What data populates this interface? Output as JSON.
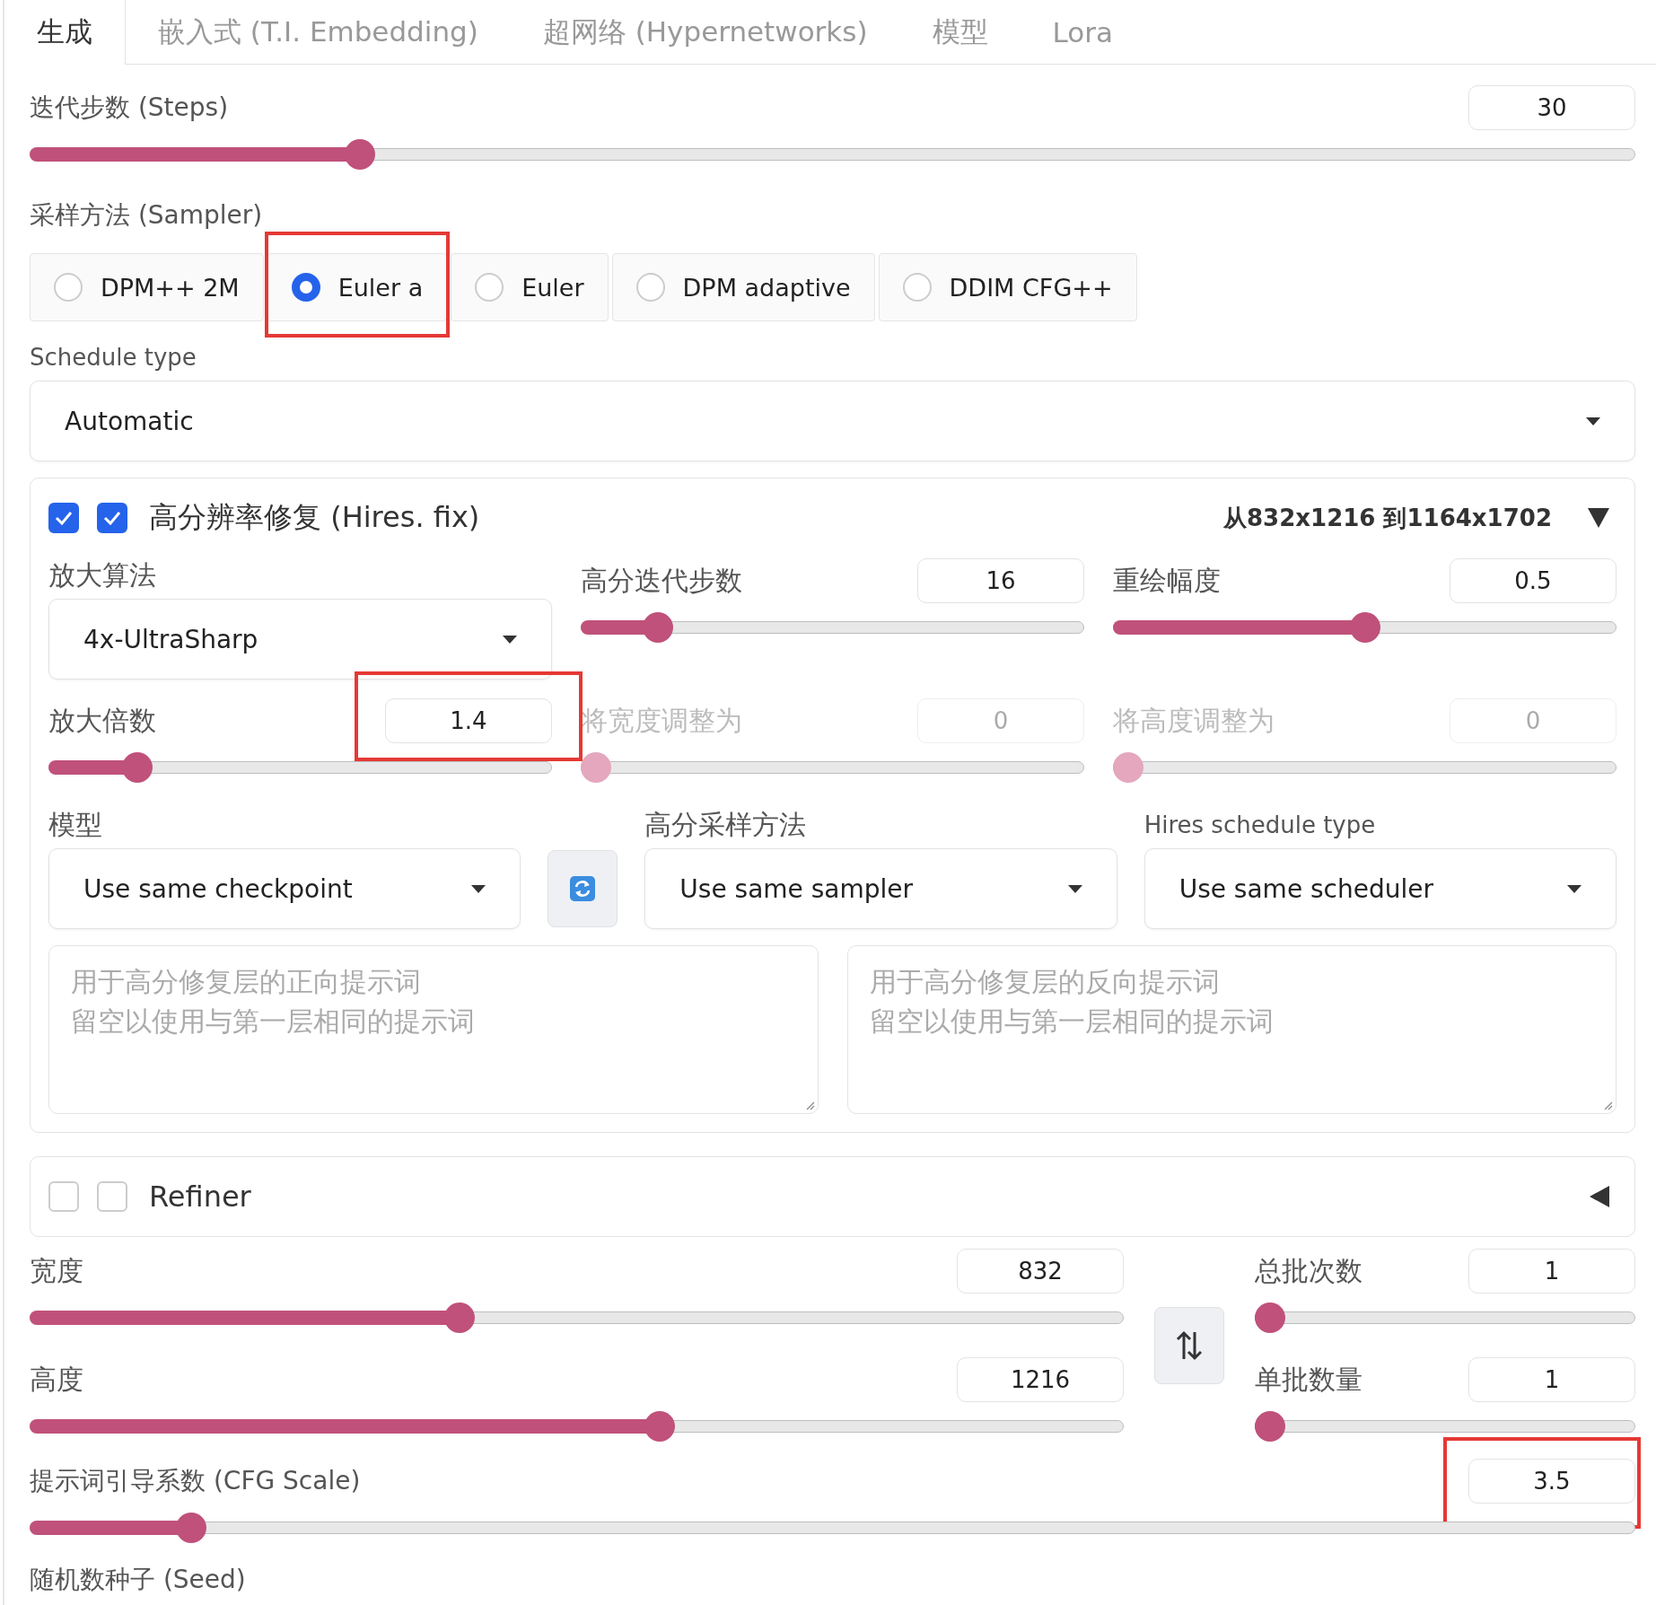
{
  "tabs": [
    {
      "label": "生成",
      "selected": true
    },
    {
      "label": "嵌入式 (T.I. Embedding)",
      "selected": false
    },
    {
      "label": "超网络 (Hypernetworks)",
      "selected": false
    },
    {
      "label": "模型",
      "selected": false
    },
    {
      "label": "Lora",
      "selected": false
    }
  ],
  "steps": {
    "label": "迭代步数 (Steps)",
    "value": "30",
    "level": 0.2
  },
  "sampler": {
    "label": "采样方法 (Sampler)",
    "options": [
      {
        "label": "DPM++ 2M",
        "selected": false
      },
      {
        "label": "Euler a",
        "selected": true,
        "highlighted": true
      },
      {
        "label": "Euler",
        "selected": false
      },
      {
        "label": "DPM adaptive",
        "selected": false
      },
      {
        "label": "DDIM CFG++",
        "selected": false
      }
    ]
  },
  "schedule_type": {
    "label": "Schedule type",
    "value": "Automatic"
  },
  "hires_fix": {
    "checkboxes": [
      {
        "checked": true
      },
      {
        "checked": true
      }
    ],
    "title": "高分辨率修复 (Hires. fix)",
    "summary": "从832x1216 到1164x1702",
    "expanded": true,
    "upscaler": {
      "label": "放大算法",
      "value": "4x-UltraSharp"
    },
    "sliders": [
      {
        "label": "高分迭代步数",
        "value": "16",
        "level": 0.13,
        "disabled": false
      },
      {
        "label": "重绘幅度",
        "value": "0.5",
        "level": 0.5,
        "disabled": false
      },
      {
        "label": "放大倍数",
        "value": "1.4",
        "level": 0.155,
        "disabled": false,
        "highlighted": true
      },
      {
        "label": "将宽度调整为",
        "value": "0",
        "level": 0,
        "disabled": true
      },
      {
        "label": "将高度调整为",
        "value": "0",
        "level": 0,
        "disabled": true
      }
    ],
    "model": {
      "label": "模型",
      "value": "Use same checkpoint"
    },
    "hires_sampler": {
      "label": "高分采样方法",
      "value": "Use same sampler"
    },
    "hires_schedule": {
      "label": "Hires schedule type",
      "value": "Use same scheduler"
    },
    "prompts": [
      {
        "placeholder_lines": [
          "用于高分修复层的正向提示词",
          "留空以使用与第一层相同的提示词"
        ]
      },
      {
        "placeholder_lines": [
          "用于高分修复层的反向提示词",
          "留空以使用与第一层相同的提示词"
        ]
      }
    ]
  },
  "refiner": {
    "checkboxes": [
      {
        "checked": false
      },
      {
        "checked": false
      }
    ],
    "title": "Refiner",
    "expanded": false
  },
  "width": {
    "label": "宽度",
    "value": "832",
    "level": 0.39
  },
  "height": {
    "label": "高度",
    "value": "1216",
    "level": 0.578
  },
  "batch_count": {
    "label": "总批次数",
    "value": "1",
    "level": 0
  },
  "batch_size": {
    "label": "单批数量",
    "value": "1",
    "level": 0
  },
  "cfg_scale": {
    "label": "提示词引导系数 (CFG Scale)",
    "value": "3.5",
    "level": 0.093,
    "highlighted": true
  },
  "seed": {
    "label": "随机数种子 (Seed)"
  }
}
